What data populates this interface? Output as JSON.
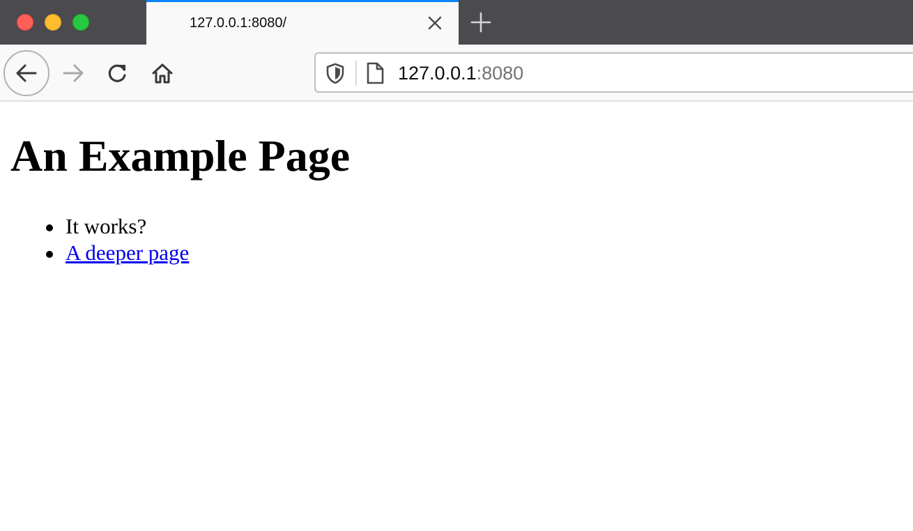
{
  "window": {
    "controls": [
      "close",
      "minimize",
      "maximize"
    ]
  },
  "tab": {
    "title": "127.0.0.1:8080/",
    "close_icon": "close-icon"
  },
  "toolbar": {
    "back_icon": "back-arrow-icon",
    "forward_icon": "forward-arrow-icon",
    "reload_icon": "reload-icon",
    "home_icon": "home-icon",
    "url_host": "127.0.0.1",
    "url_port": ":8080"
  },
  "page": {
    "heading": "An Example Page",
    "items": [
      {
        "text": "It works?",
        "is_link": false
      },
      {
        "text": "A deeper page",
        "is_link": true
      }
    ]
  },
  "colors": {
    "tab_accent": "#0a84ff",
    "link": "#0000ee",
    "tabstrip_bg": "#4a4a4f"
  }
}
